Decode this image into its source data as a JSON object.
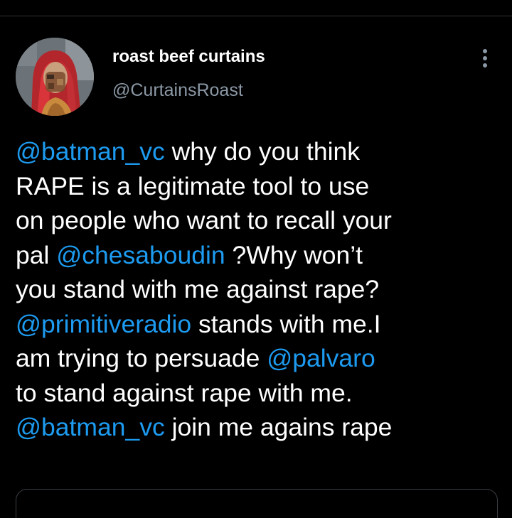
{
  "tweet": {
    "author": {
      "display_name": "roast beef curtains",
      "handle": "@CurtainsRoast",
      "avatar": "avatar-image"
    },
    "more_icon": "more-vertical-icon",
    "lines": [
      [
        {
          "text": "@batman_vc",
          "type": "mention"
        },
        {
          "text": " why do you think",
          "type": "text"
        }
      ],
      [
        {
          "text": "RAPE is a legitimate tool to use",
          "type": "text"
        }
      ],
      [
        {
          "text": "on people who want to recall your",
          "type": "text"
        }
      ],
      [
        {
          "text": "pal ",
          "type": "text"
        },
        {
          "text": "@chesaboudin",
          "type": "mention"
        },
        {
          "text": " ?Why won’t",
          "type": "text"
        }
      ],
      [
        {
          "text": "you stand with me against rape?",
          "type": "text"
        }
      ],
      [
        {
          "text": "@primitiveradio",
          "type": "mention"
        },
        {
          "text": " stands with me.I",
          "type": "text"
        }
      ],
      [
        {
          "text": "am trying to persuade ",
          "type": "text"
        },
        {
          "text": "@palvaro",
          "type": "mention"
        }
      ],
      [
        {
          "text": "to stand against rape with me.",
          "type": "text"
        }
      ],
      [
        {
          "text": "@batman_vc",
          "type": "mention"
        },
        {
          "text": " join me agains rape",
          "type": "text"
        }
      ]
    ]
  },
  "colors": {
    "background": "#000000",
    "text": "#ffffff",
    "secondary_text": "#8b98a5",
    "mention": "#1d9bf0",
    "divider": "#2f3336"
  }
}
